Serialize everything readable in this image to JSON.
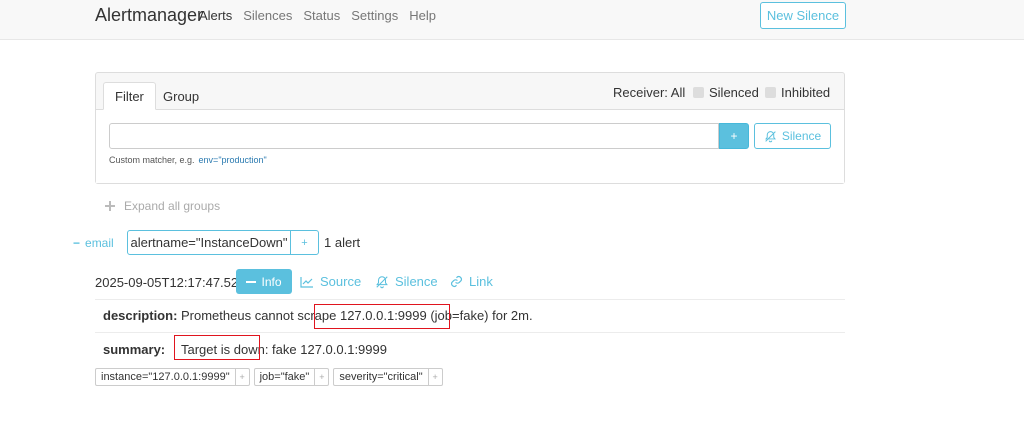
{
  "navbar": {
    "brand": "Alertmanager",
    "items": [
      {
        "label": "Alerts",
        "active": true
      },
      {
        "label": "Silences",
        "active": false
      },
      {
        "label": "Status",
        "active": false
      },
      {
        "label": "Settings",
        "active": false
      },
      {
        "label": "Help",
        "active": false
      }
    ],
    "new_silence_label": "New Silence"
  },
  "filter_card": {
    "tabs": [
      "Filter",
      "Group"
    ],
    "receiver_label": "Receiver: All",
    "silenced_label": "Silenced",
    "inhibited_label": "Inhibited",
    "input_value": "",
    "add_label": "+",
    "silence_button_label": "Silence",
    "hint_text": "Custom matcher, e.g.",
    "hint_example": "env=\"production\""
  },
  "expand_all_label": "Expand all groups",
  "group": {
    "toggle_symbol": "−",
    "receiver": "email",
    "label": "alertname=\"InstanceDown\"",
    "add_label": "+",
    "count_text": "1 alert"
  },
  "alert": {
    "timestamp": "2025-09-05T12:17:47.520Z",
    "info_label": "Info",
    "source_label": "Source",
    "silence_label": "Silence",
    "link_label": "Link",
    "annotations": [
      {
        "key": "description:",
        "value": "Prometheus cannot scrape 127.0.0.1:9999 (job=fake) for 2m."
      },
      {
        "key": "summary:",
        "value": "Target is down: fake 127.0.0.1:9999"
      }
    ],
    "labels": [
      {
        "text": "instance=\"127.0.0.1:9999\"",
        "add": "+"
      },
      {
        "text": "job=\"fake\"",
        "add": "+"
      },
      {
        "text": "severity=\"critical\"",
        "add": "+"
      }
    ]
  },
  "colors": {
    "accent": "#5bc0de",
    "highlight_box": "#e0141e"
  }
}
